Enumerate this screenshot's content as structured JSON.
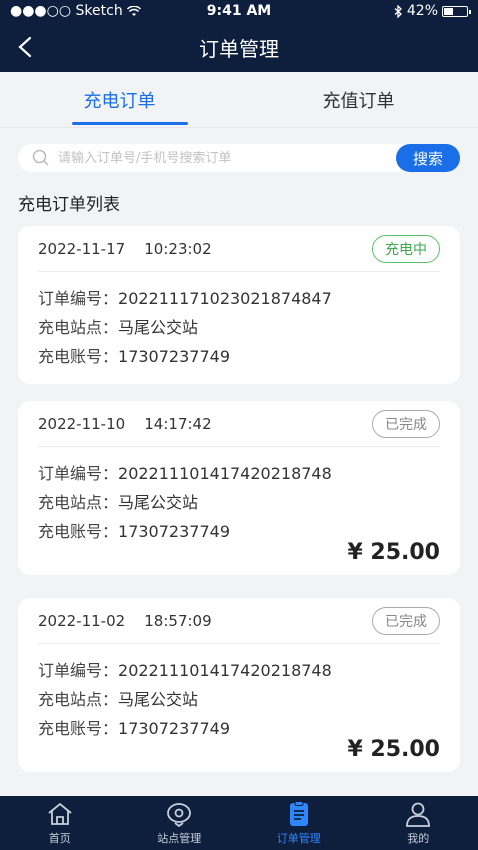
{
  "status": {
    "carrier": "●●●○○ Sketch",
    "time": "9:41 AM",
    "battery": "42%",
    "battery_level": 0.42
  },
  "nav": {
    "title": "订单管理"
  },
  "tabs": [
    {
      "label": "充电订单",
      "active": true
    },
    {
      "label": "充值订单",
      "active": false
    }
  ],
  "search": {
    "placeholder": "请输入订单号/手机号搜索订单",
    "button": "搜索"
  },
  "section_title": "充电订单列表",
  "labels": {
    "order_no": "订单编号：",
    "station": "充电站点：",
    "account": "充电账号："
  },
  "orders": [
    {
      "date": "2022-11-17",
      "time": "10:23:02",
      "status": "充电中",
      "order_no": "20221117102302187484​7",
      "station": "马尾公交站",
      "account": "17307237749",
      "amount": ""
    },
    {
      "date": "2022-11-10",
      "time": "14:17:42",
      "status": "已完成",
      "order_no": "202211101417420218748",
      "station": "马尾公交站",
      "account": "17307237749",
      "amount": "¥ 25.00"
    },
    {
      "date": "2022-11-02",
      "time": "18:57:09",
      "status": "已完成",
      "order_no": "202211101417420218748",
      "station": "马尾公交站",
      "account": "17307237749",
      "amount": "¥ 25.00"
    }
  ],
  "tabbar": [
    {
      "label": "首页",
      "icon": "home-icon",
      "active": false
    },
    {
      "label": "站点管理",
      "icon": "location-icon",
      "active": false
    },
    {
      "label": "订单管理",
      "icon": "order-icon",
      "active": true
    },
    {
      "label": "我的",
      "icon": "user-icon",
      "active": false
    }
  ],
  "colors": {
    "nav_bg": "#0d1f3c",
    "accent": "#1a6fe8",
    "charging": "#3fa84f"
  }
}
